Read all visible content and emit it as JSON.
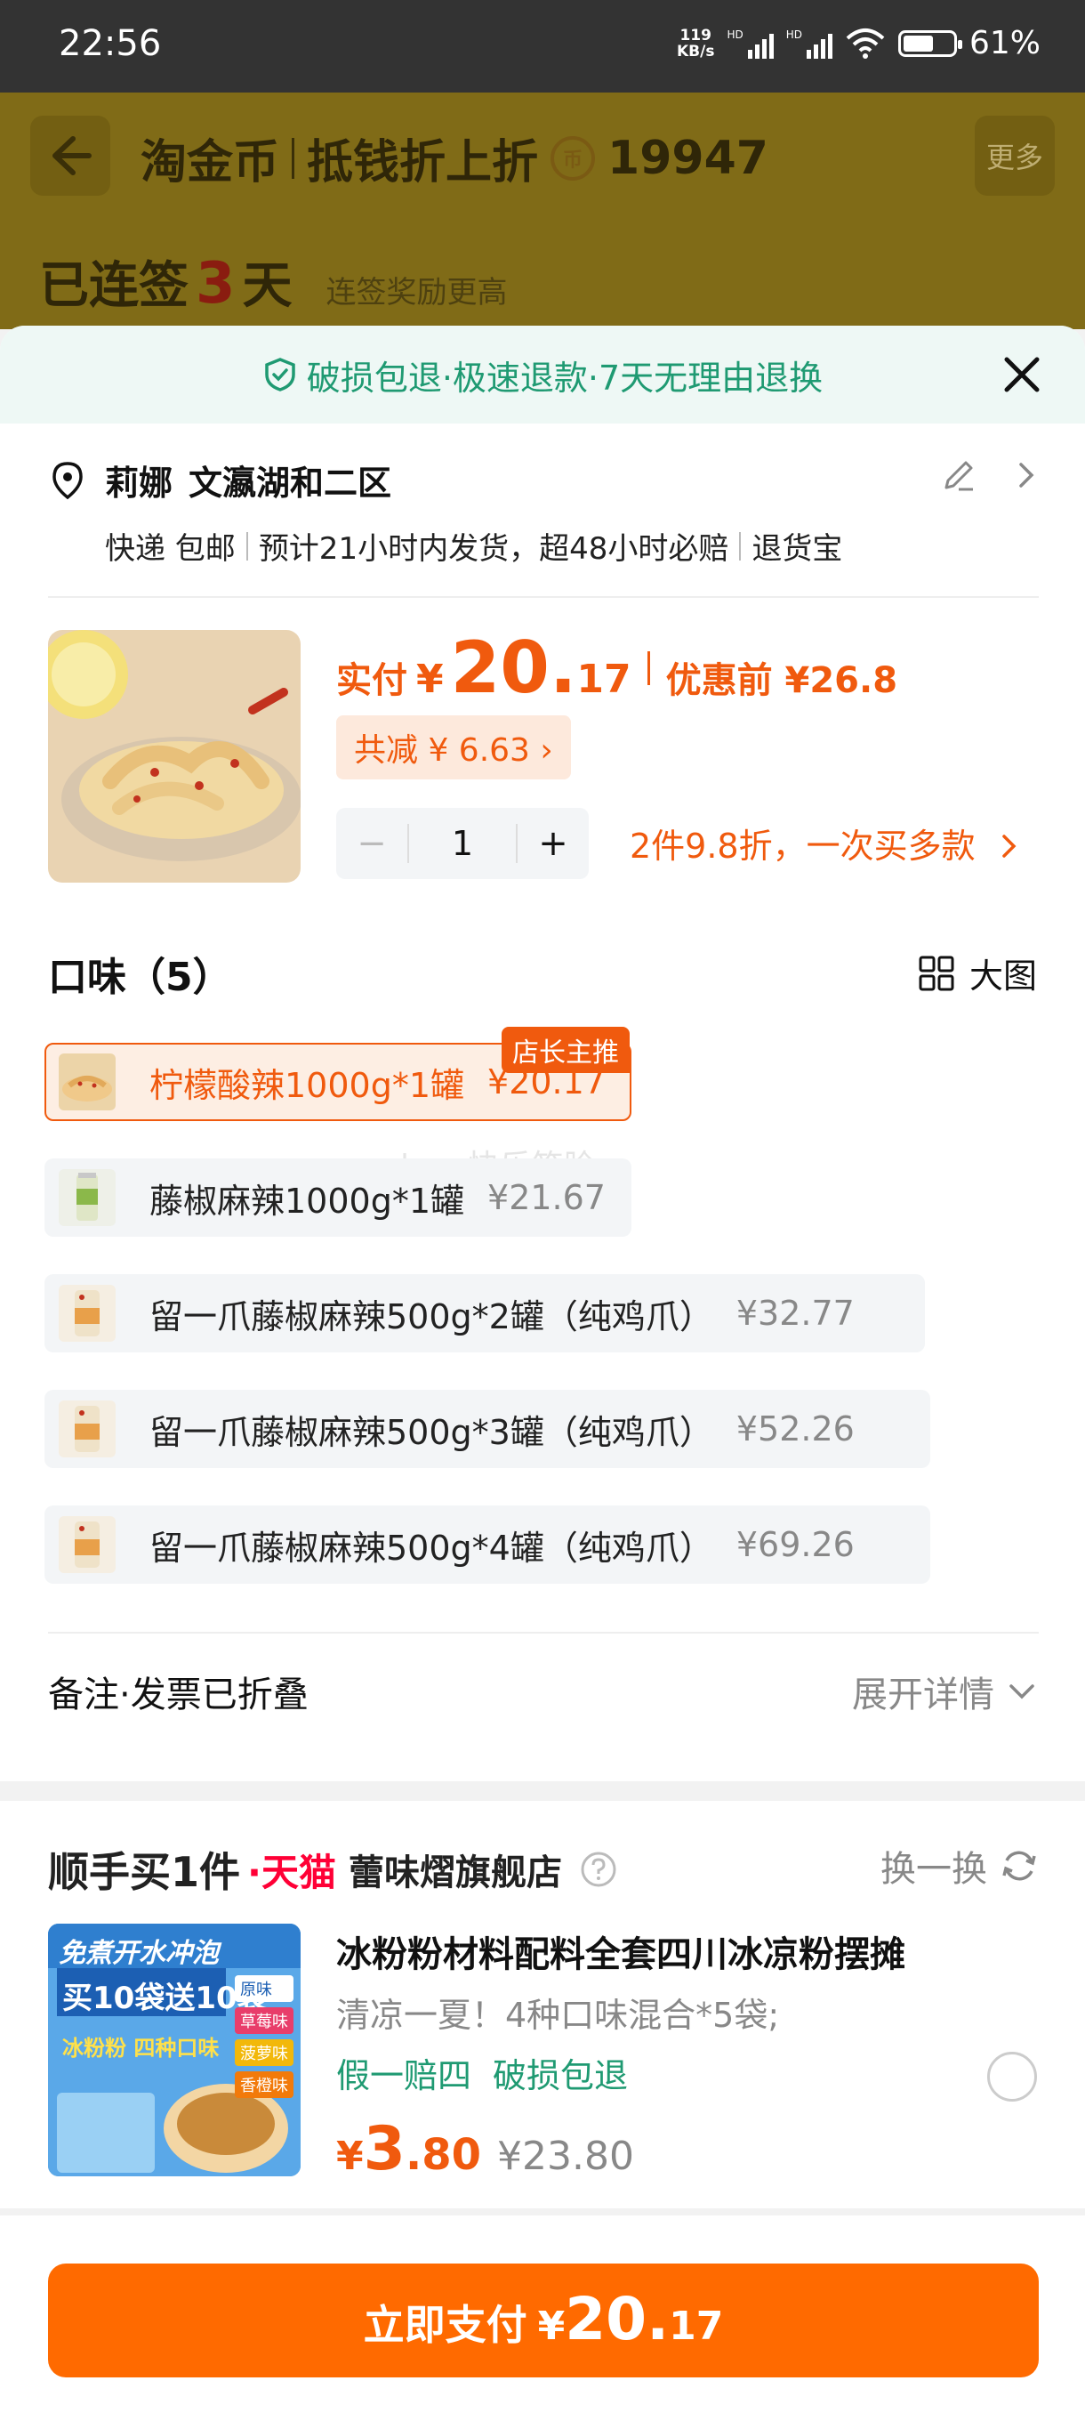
{
  "status_bar": {
    "time": "22:56",
    "net_speed_value": "119",
    "net_speed_unit": "KB/s",
    "hd1": "HD",
    "hd2": "HD",
    "battery": "61%",
    "battery_level": 0.61
  },
  "background_page": {
    "title": "淘金币",
    "subtitle": "抵钱折上折",
    "coin_glyph": "币",
    "coin_count": "19947",
    "more_label": "更多",
    "streak_prefix": "已连签",
    "streak_days": "3",
    "streak_suffix": "天",
    "streak_note": "连签奖励更高"
  },
  "sheet": {
    "guarantee_text": "破损包退·极速退款·7天无理由退换",
    "address": {
      "name": "莉娜",
      "location": "文瀛湖和二区",
      "delivery": "快递 包邮",
      "ship_time": "预计21小时内发货，超48小时必赔",
      "return": "退货宝"
    },
    "product": {
      "paid_label": "实付",
      "yen": "¥",
      "price_int": "20.",
      "price_dec": "17",
      "before_label": "优惠前 ¥26.8",
      "discount_chip": "共减 ¥ 6.63 ›",
      "quantity": "1",
      "minus": "−",
      "plus": "+",
      "bulk_offer": "2件9.8折，一次买多款"
    },
    "flavor": {
      "heading": "口味（5）",
      "big_view": "大图",
      "options": [
        {
          "name": "柠檬酸辣1000g*1罐",
          "price": "¥20.17",
          "badge": "店长主推"
        },
        {
          "name": "藤椒麻辣1000g*1罐",
          "price": "¥21.67"
        },
        {
          "name": "留一爪藤椒麻辣500g*2罐（纯鸡爪）",
          "price": "¥32.77"
        },
        {
          "name": "留一爪藤椒麻辣500g*3罐（纯鸡爪）",
          "price": "¥52.26"
        },
        {
          "name": "留一爪藤椒麻辣500g*4罐（纯鸡爪）",
          "price": "¥69.26"
        }
      ],
      "watermark": "love快乐笑脸"
    },
    "note": {
      "label": "备注·发票已折叠",
      "expand": "展开详情"
    },
    "upsell": {
      "buy_one": "顺手买1件",
      "dot": "·",
      "tmall": "天猫",
      "store": "蕾味熠旗舰店",
      "swap": "换一换",
      "title": "冰粉粉材料配料全套四川冰凉粉摆摊",
      "desc": "清凉一夏！4种口味混合*5袋;",
      "tag1": "假一赔四",
      "tag2": "破损包退",
      "yen": "¥",
      "price_int": "3",
      "price_dec": ".80",
      "orig_price": "¥23.80",
      "img_text_top": "免煮开水冲泡",
      "img_text_main": "买10袋送10袋",
      "img_text_sub": "冰粉粉 四种口味",
      "img_flavors": [
        "原味",
        "草莓味",
        "菠萝味",
        "香橙味"
      ]
    },
    "pay": {
      "label": "立即支付",
      "yen": "¥",
      "price_int": "20.",
      "price_dec": "17"
    }
  },
  "colors": {
    "accent": "#f05a0e",
    "pay_button": "#ff6a00",
    "guarantee_green": "#1f9a72",
    "tmall_red": "#ff0036"
  }
}
